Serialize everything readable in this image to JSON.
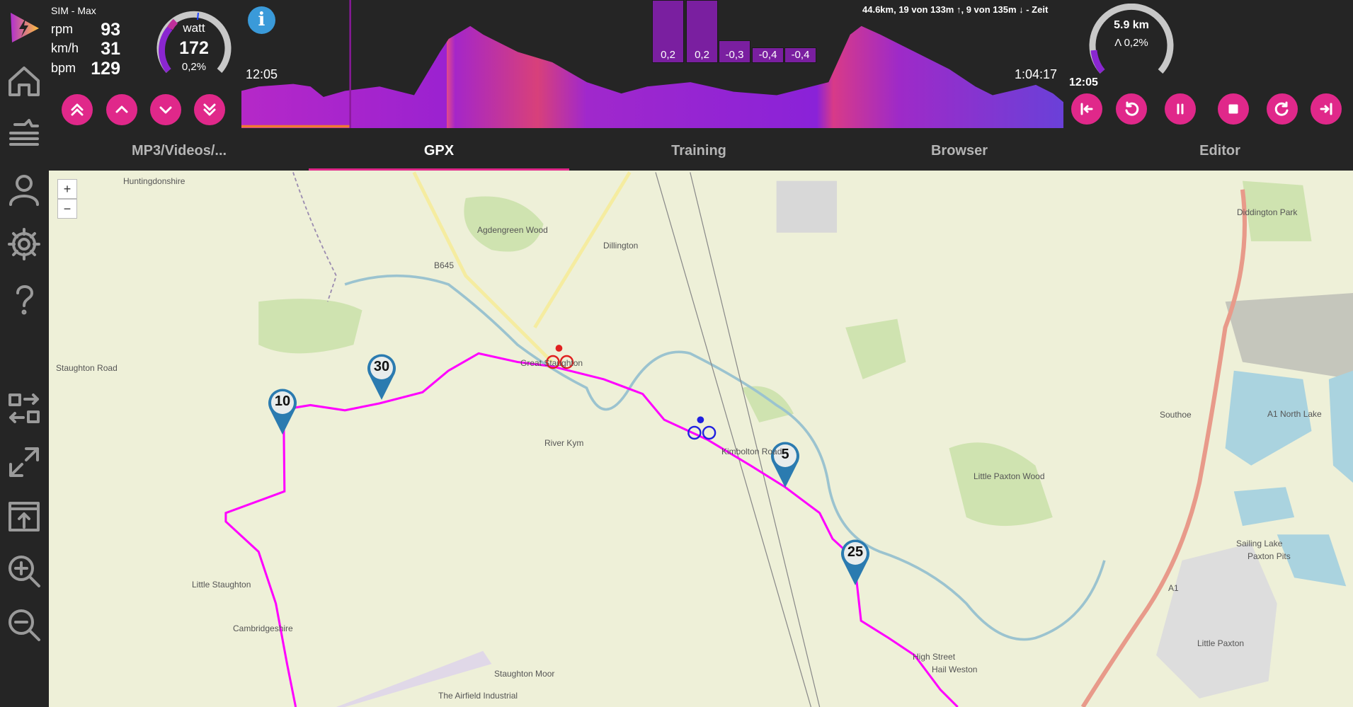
{
  "app": {
    "profile": "SIM - Max"
  },
  "stats": [
    {
      "label": "rpm",
      "value": "93"
    },
    {
      "label": "km/h",
      "value": "31"
    },
    {
      "label": "bpm",
      "value": "129"
    }
  ],
  "power_gauge": {
    "label": "watt",
    "value": "172",
    "grade": "0,2%"
  },
  "elevation": {
    "summary": "44.6km, 19 von 133m ↑, 9 von 135m ↓ - Zeit",
    "start_time": "12:05",
    "end_time": "1:04:17",
    "grades": [
      "0,2",
      "0,2",
      "-0,3",
      "-0,4",
      "-0,4"
    ]
  },
  "distance_gauge": {
    "distance": "5.9 km",
    "grade": "Λ 0,2%",
    "time": "12:05"
  },
  "tabs": [
    {
      "label": "MP3/Videos/..."
    },
    {
      "label": "GPX"
    },
    {
      "label": "Training"
    },
    {
      "label": "Browser"
    },
    {
      "label": "Editor"
    }
  ],
  "active_tab": "GPX",
  "map": {
    "zoom_in": "+",
    "zoom_out": "−",
    "markers": [
      "10",
      "30",
      "5",
      "25"
    ],
    "places": [
      "Dillington",
      "B645",
      "Agdengreen Wood",
      "Great Staughton",
      "Staughton Road",
      "Little Staughton",
      "Southoe",
      "Little Paxton Wood",
      "Little Paxton",
      "Hail Weston",
      "Staughton Moor",
      "River Kym",
      "A1",
      "Diddington Park",
      "A1 North Lake",
      "Paxton Pits",
      "Huntingdonshire",
      "Cambridgeshire",
      "High Street",
      "The Airfield Industrial",
      "Sailing Lake",
      "Kimbolton Road"
    ]
  },
  "colors": {
    "accent": "#e0288a",
    "route": "#ff00ff",
    "marker": "#2b7bb0",
    "background": "#252525"
  }
}
